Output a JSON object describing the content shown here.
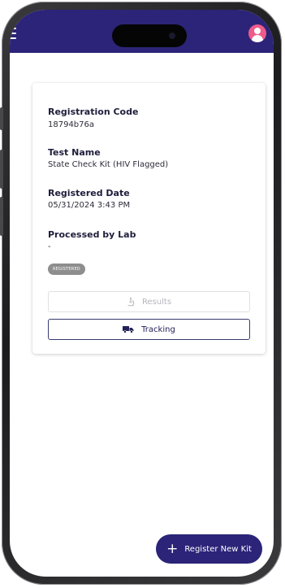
{
  "card": {
    "registration_code_label": "Registration Code",
    "registration_code_value": "18794b76a",
    "test_name_label": "Test Name",
    "test_name_value": "State Check Kit (HIV Flagged)",
    "registered_date_label": "Registered Date",
    "registered_date_value": "05/31/2024 3:43 PM",
    "processed_by_lab_label": "Processed by Lab",
    "processed_by_lab_value": "-",
    "status_badge": "REGISTERED",
    "results_button": "Results",
    "tracking_button": "Tracking"
  },
  "fab": {
    "label": "Register New Kit"
  },
  "icons": {
    "menu": "hamburger-menu-icon",
    "avatar": "user-avatar-icon",
    "results": "microscope-icon",
    "tracking": "truck-icon",
    "fab": "plus-icon"
  },
  "colors": {
    "header": "#2b2478",
    "avatar": "#ee5a8a",
    "badge": "#8e8e8e",
    "fab": "#2b2478"
  }
}
